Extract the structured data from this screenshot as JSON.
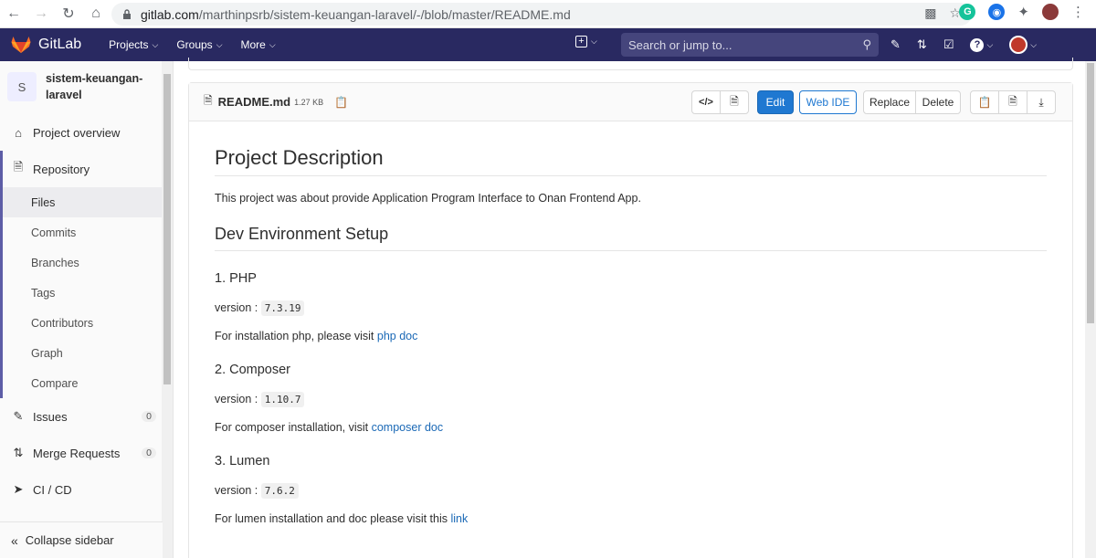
{
  "browser": {
    "url_host": "gitlab.com",
    "url_path": "/marthinpsrb/sistem-keuangan-laravel/-/blob/master/README.md"
  },
  "header": {
    "brand": "GitLab",
    "menu": [
      {
        "label": "Projects"
      },
      {
        "label": "Groups"
      },
      {
        "label": "More"
      }
    ],
    "search_placeholder": "Search or jump to..."
  },
  "sidebar": {
    "project_avatar": "S",
    "project_name_line1": "sistem-keuangan-",
    "project_name_line2": "laravel",
    "items": {
      "overview": "Project overview",
      "repository": "Repository",
      "files": "Files",
      "commits": "Commits",
      "branches": "Branches",
      "tags": "Tags",
      "contributors": "Contributors",
      "graph": "Graph",
      "compare": "Compare",
      "issues": "Issues",
      "issues_count": "0",
      "merge_requests": "Merge Requests",
      "merge_requests_count": "0",
      "cicd": "CI / CD",
      "collapse": "Collapse sidebar"
    }
  },
  "file": {
    "name": "README.md",
    "size": "1.27 KB",
    "buttons": {
      "edit": "Edit",
      "web_ide": "Web IDE",
      "replace": "Replace",
      "delete": "Delete"
    }
  },
  "readme": {
    "h1": "Project Description",
    "intro": "This project was about provide Application Program Interface to Onan Frontend App.",
    "h2": "Dev Environment Setup",
    "php": {
      "title": "1. PHP",
      "version_label": "version :",
      "version": "7.3.19",
      "install_text": "For installation php, please visit",
      "link": "php doc"
    },
    "composer": {
      "title": "2. Composer",
      "version_label": "version :",
      "version": "1.10.7",
      "install_text": "For composer installation, visit",
      "link": "composer doc"
    },
    "lumen": {
      "title": "3. Lumen",
      "version_label": "version :",
      "version": "7.6.2",
      "install_text": "For lumen installation and doc please visit this",
      "link": "link"
    }
  },
  "colors": {
    "header_bg": "#292961",
    "primary": "#1f78d1",
    "link": "#1b69b6"
  }
}
